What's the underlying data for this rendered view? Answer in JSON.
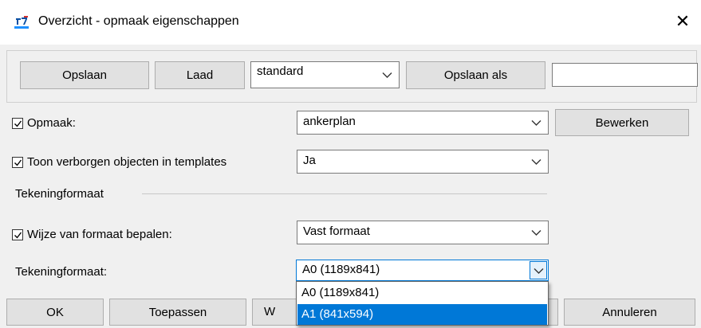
{
  "window": {
    "title": "Overzicht - opmaak eigenschappen",
    "close_glyph": "✕",
    "icon": "app-icon"
  },
  "toolbar": {
    "save_label": "Opslaan",
    "load_label": "Laad",
    "profile_value": "standard",
    "save_as_label": "Opslaan als",
    "save_as_value": ""
  },
  "settings": {
    "opmaak": {
      "label": "Opmaak:",
      "checked": true,
      "value": "ankerplan",
      "edit_label": "Bewerken"
    },
    "hidden_objects": {
      "label": "Toon verborgen objecten in templates",
      "checked": true,
      "value": "Ja"
    },
    "section_title": "Tekeningformaat",
    "format_method": {
      "label": "Wijze van formaat bepalen:",
      "checked": true,
      "value": "Vast formaat"
    },
    "drawing_format": {
      "label": "Tekeningformaat:",
      "value": "A0 (1189x841)",
      "options": [
        "A0 (1189x841)",
        "A1 (841x594)"
      ],
      "highlighted": "A1 (841x594)"
    }
  },
  "footer": {
    "ok_label": "OK",
    "apply_label": "Toepassen",
    "partial_label": "W",
    "cancel_label": "Annuleren"
  },
  "colors": {
    "accent": "#0078d7",
    "window_bg": "#f0f0f0",
    "button_bg": "#e1e1e1"
  }
}
